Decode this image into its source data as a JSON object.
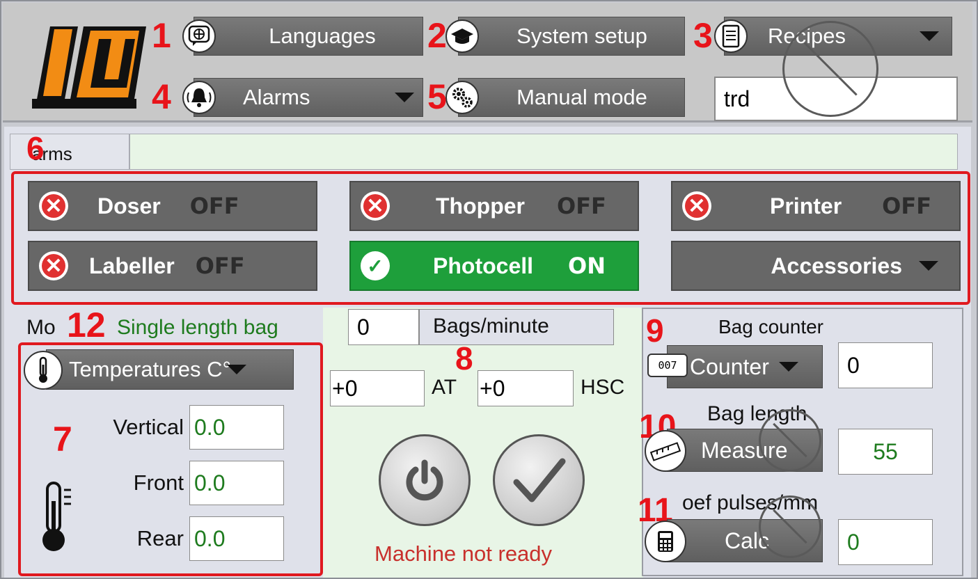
{
  "header": {
    "languages_label": "Languages",
    "system_setup_label": "System setup",
    "recipes_label": "Recipes",
    "alarms_label": "Alarms",
    "manual_mode_label": "Manual mode",
    "recipe_field_value": "trd"
  },
  "annotations": [
    "1",
    "2",
    "3",
    "4",
    "5",
    "6",
    "7",
    "8",
    "9",
    "10",
    "11",
    "12"
  ],
  "alarms_bar": {
    "label": "arms"
  },
  "status_buttons": [
    {
      "name": "Doser",
      "state": "OFF"
    },
    {
      "name": "Thopper",
      "state": "OFF"
    },
    {
      "name": "Printer",
      "state": "OFF"
    },
    {
      "name": "Labeller",
      "state": "OFF"
    },
    {
      "name": "Photocell",
      "state": "ON"
    },
    {
      "name": "Accessories"
    }
  ],
  "mode": {
    "label": "Mo",
    "value": "Single length bag"
  },
  "temperatures": {
    "dropdown_label": "Temperatures C°",
    "rows": [
      {
        "label": "Vertical",
        "value": "0.0"
      },
      {
        "label": "Front",
        "value": "0.0"
      },
      {
        "label": "Rear",
        "value": "0.0"
      }
    ]
  },
  "speed": {
    "value": "0",
    "unit": "Bags/minute"
  },
  "offsets": {
    "at_value": "+0",
    "at_label": "AT",
    "hsc_value": "+0",
    "hsc_label": "HSC"
  },
  "machine_status": "Machine not ready",
  "counters": {
    "bag_counter_title": "Bag counter",
    "counter_label": "Counter",
    "counter_value": "0",
    "counter_digits": "007",
    "bag_length_title": "Bag length",
    "measure_label": "Measure",
    "bag_length_value": "55",
    "coef_title": "oef pulses/mm",
    "calc_label": "Calc",
    "coef_value": "0"
  },
  "colors": {
    "red_annotation": "#e0191f",
    "on_green": "#1e9f3b",
    "off_x": "#e03131",
    "status_text": "#c8302c",
    "mode_text": "#1e7b1e"
  }
}
